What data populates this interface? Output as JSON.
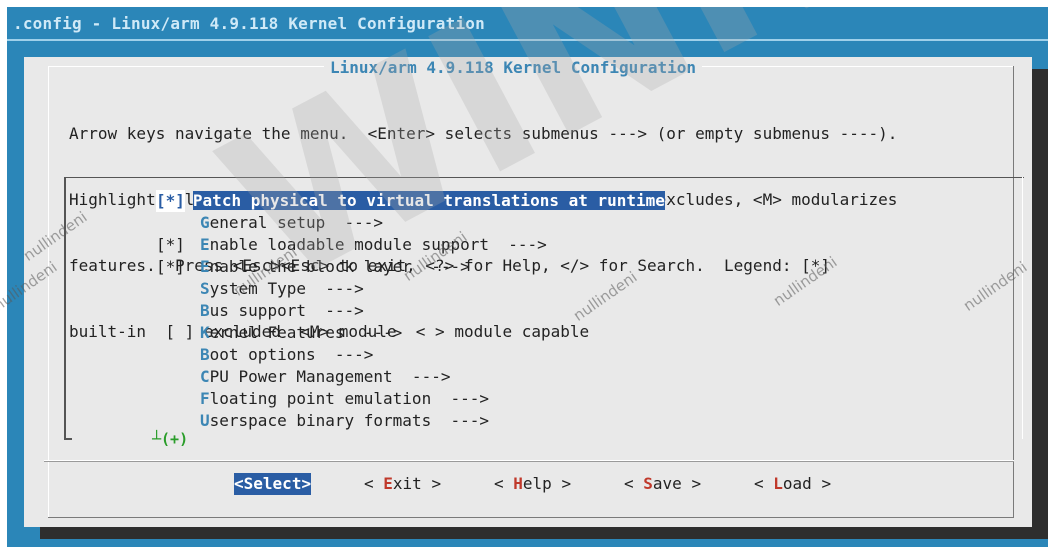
{
  "window": {
    "title": ".config - Linux/arm 4.9.118 Kernel Configuration"
  },
  "dialog": {
    "title": "Linux/arm 4.9.118 Kernel Configuration",
    "help_lines": [
      "Arrow keys navigate the menu.  <Enter> selects submenus ---> (or empty submenus ----).",
      "Highlighted letters are hotkeys.  Pressing <Y> includes, <N> excludes, <M> modularizes",
      "features.  Press <Esc><Esc> to exit, <?> for Help, </> for Search.  Legend: [*]",
      "built-in  [ ] excluded  <M> module  < > module capable"
    ]
  },
  "menu": {
    "items": [
      {
        "prefix": "[*]",
        "hotkey": "P",
        "rest": "atch physical to virtual translations at runtime",
        "selected": true
      },
      {
        "prefix": "",
        "hotkey": "G",
        "rest": "eneral setup  --->",
        "selected": false
      },
      {
        "prefix": "[*]",
        "hotkey": "E",
        "rest": "nable loadable module support  --->",
        "selected": false
      },
      {
        "prefix": "[*]",
        "hotkey": "E",
        "rest": "nable the block layer  --->",
        "selected": false
      },
      {
        "prefix": "",
        "hotkey": "S",
        "rest": "ystem Type  --->",
        "selected": false
      },
      {
        "prefix": "",
        "hotkey": "B",
        "rest": "us support  --->",
        "selected": false
      },
      {
        "prefix": "",
        "hotkey": "K",
        "rest": "ernel Features  --->",
        "selected": false
      },
      {
        "prefix": "",
        "hotkey": "B",
        "rest": "oot options  --->",
        "selected": false
      },
      {
        "prefix": "",
        "hotkey": "C",
        "rest": "PU Power Management  --->",
        "selected": false
      },
      {
        "prefix": "",
        "hotkey": "F",
        "rest": "loating point emulation  --->",
        "selected": false
      },
      {
        "prefix": "",
        "hotkey": "U",
        "rest": "serspace binary formats  --->",
        "selected": false
      }
    ],
    "more_indicator": "┴(+)"
  },
  "buttons": [
    {
      "pre": "<",
      "hotkey": "S",
      "post": "elect>",
      "active": true
    },
    {
      "pre": "< ",
      "hotkey": "E",
      "post": "xit >",
      "active": false
    },
    {
      "pre": "< ",
      "hotkey": "H",
      "post": "elp >",
      "active": false
    },
    {
      "pre": "< ",
      "hotkey": "S",
      "post": "ave >",
      "active": false
    },
    {
      "pre": "< ",
      "hotkey": "L",
      "post": "oad >",
      "active": false
    }
  ],
  "watermarks": {
    "text": "nullindeni",
    "logo": "WINNER"
  }
}
